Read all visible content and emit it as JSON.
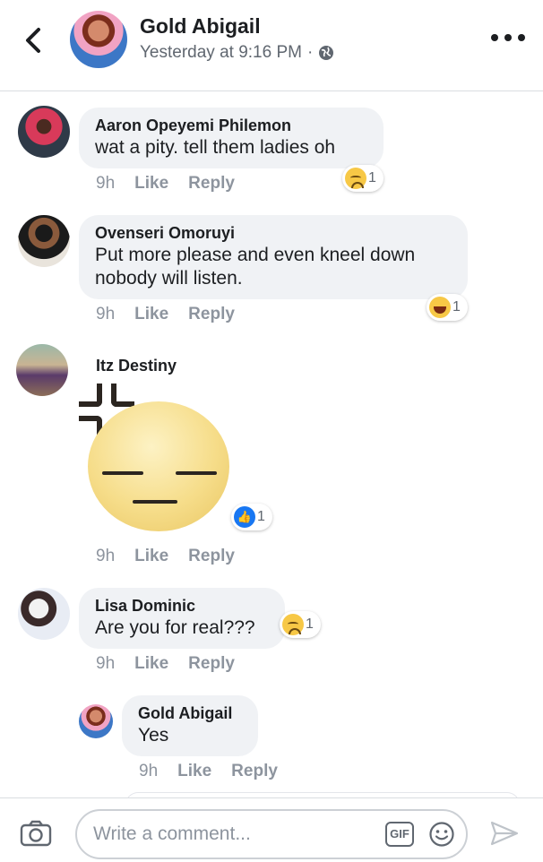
{
  "header": {
    "name": "Gold Abigail",
    "timestamp": "Yesterday at 9:16 PM",
    "separator": "·",
    "icons": {
      "back": "chevron-left-icon",
      "privacy": "globe-icon",
      "more": "more-dots-icon"
    }
  },
  "comments": [
    {
      "author": "Aaron Opeyemi Philemon",
      "text": "wat a pity. tell them ladies oh",
      "time": "9h",
      "like": "Like",
      "reply": "Reply",
      "reaction": {
        "type": "sad",
        "count": "1"
      }
    },
    {
      "author": "Ovenseri Omoruyi",
      "text_lines": [
        "Put more please and even kneel down",
        "nobody will listen."
      ],
      "time": "9h",
      "like": "Like",
      "reply": "Reply",
      "reaction": {
        "type": "haha",
        "count": "1"
      }
    },
    {
      "author": "Itz Destiny",
      "sticker": "annoyed-face-sticker",
      "time": "9h",
      "like": "Like",
      "reply": "Reply",
      "reaction": {
        "type": "like",
        "count": "1"
      }
    },
    {
      "author": "Lisa Dominic",
      "text": "Are you for real???",
      "time": "9h",
      "like": "Like",
      "reply": "Reply",
      "reaction": {
        "type": "sad",
        "count": "1"
      }
    }
  ],
  "reply": {
    "author": "Gold Abigail",
    "text": "Yes",
    "time": "9h",
    "like": "Like",
    "reply": "Reply"
  },
  "composer": {
    "placeholder": "Write a comment...",
    "gif_label": "GIF",
    "icons": {
      "camera": "camera-icon",
      "emoji": "emoji-icon",
      "send": "send-icon"
    }
  },
  "colors": {
    "bubble": "#f0f2f5",
    "meta_text": "#8d949e",
    "like_blue": "#1877f2",
    "reaction_yellow": "#f7c846"
  }
}
